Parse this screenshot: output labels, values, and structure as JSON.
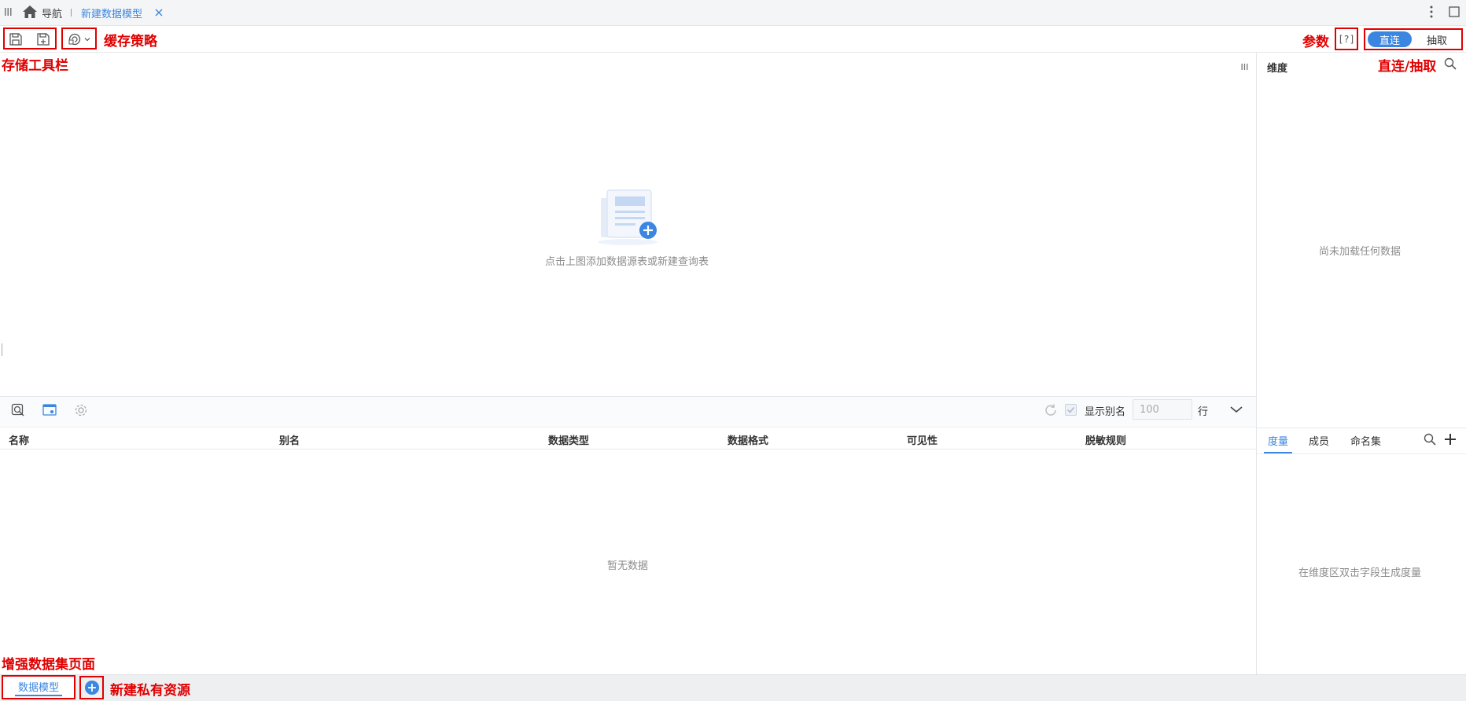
{
  "tabs": {
    "home_label": "导航",
    "active_tab_label": "新建数据模型"
  },
  "toolbar": {
    "params_symbol": "[?]",
    "mode_direct": "直连",
    "mode_extract": "抽取"
  },
  "annotations": {
    "cache_strategy": "缓存策略",
    "storage_toolbar": "存储工具栏",
    "params": "参数",
    "direct_extract": "直连/抽取",
    "enhanced_dataset_page": "增强数据集页面",
    "new_private_resource": "新建私有资源"
  },
  "canvas": {
    "empty_hint": "点击上图添加数据源表或新建查询表"
  },
  "preview": {
    "show_alias_label": "显示别名",
    "row_count_value": "100",
    "row_unit": "行",
    "columns": [
      "名称",
      "别名",
      "数据类型",
      "数据格式",
      "可见性",
      "脱敏规则"
    ],
    "empty_text": "暂无数据"
  },
  "dimension_panel": {
    "title": "维度",
    "empty_text": "尚未加载任何数据"
  },
  "measure_panel": {
    "tabs": [
      "度量",
      "成员",
      "命名集"
    ],
    "empty_text": "在维度区双击字段生成度量"
  },
  "bottom": {
    "model_tab_label": "数据模型"
  },
  "colors": {
    "accent": "#3b86e0",
    "annotation_red": "#e00000"
  }
}
